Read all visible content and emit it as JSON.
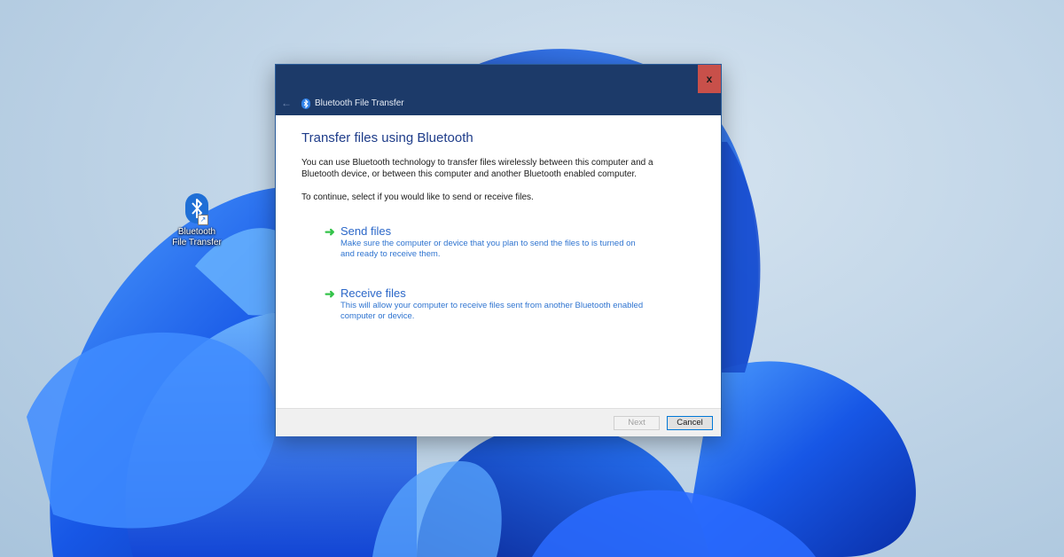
{
  "desktop": {
    "icon_label_line1": "Bluetooth",
    "icon_label_line2": "File Transfer"
  },
  "dialog": {
    "title": "Bluetooth File Transfer",
    "close_label": "x",
    "back_label": "←",
    "heading": "Transfer files using Bluetooth",
    "intro": "You can use Bluetooth technology to transfer files wirelessly between this computer and a Bluetooth device, or between this computer and another Bluetooth enabled computer.",
    "prompt": "To continue, select if you would like to send or receive files.",
    "options": [
      {
        "title": "Send files",
        "description": "Make sure the computer or device that you plan to send the files to is turned on and ready to receive them."
      },
      {
        "title": "Receive files",
        "description": "This will allow your computer to receive files sent from another Bluetooth enabled computer or device."
      }
    ],
    "buttons": {
      "next": "Next",
      "cancel": "Cancel"
    }
  },
  "colors": {
    "titlebar": "#1c3a69",
    "close": "#c8504a",
    "heading": "#1f3d8a",
    "link": "#2b67c8",
    "arrow": "#34c34a",
    "wallpaper_accent": "#1a5fe0"
  },
  "icons": [
    "bluetooth-icon",
    "back-arrow-icon",
    "close-icon",
    "green-arrow-icon",
    "shortcut-arrow-icon"
  ]
}
